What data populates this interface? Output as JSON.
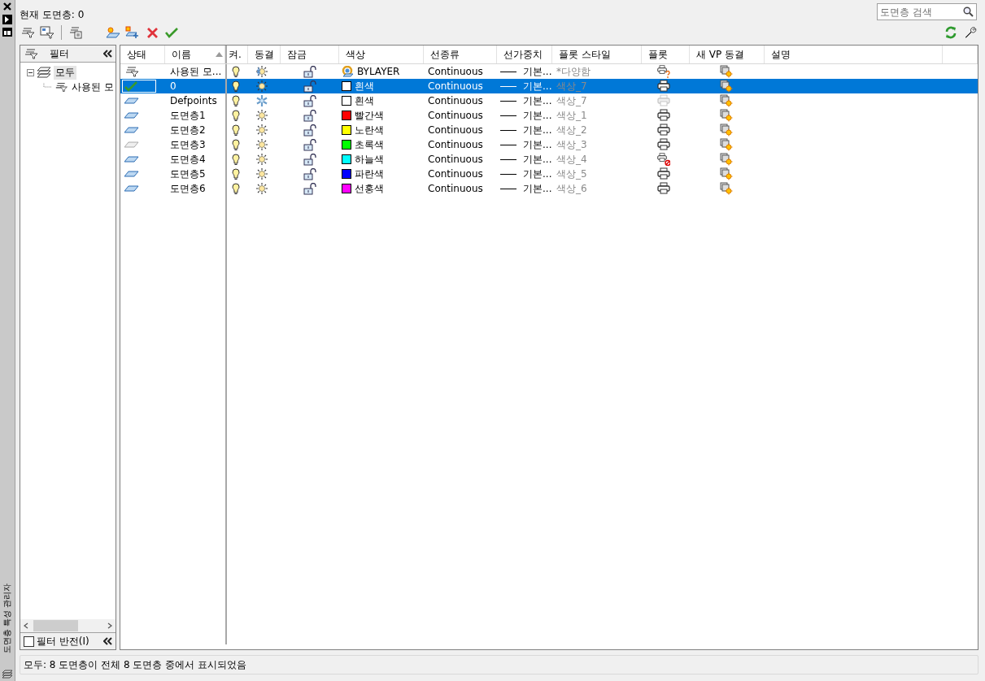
{
  "header": {
    "current_layer": "현재 도면층: 0"
  },
  "search": {
    "placeholder": "도면층 검색"
  },
  "filter_panel": {
    "title": "필터",
    "tree": [
      {
        "label": "모두",
        "selected": true,
        "expanded": true,
        "children": [
          {
            "label": "사용된 모",
            "selected": false
          }
        ]
      }
    ],
    "invert": {
      "label": "필터 반전(I)",
      "checked": false
    }
  },
  "columns": [
    {
      "label": "상태",
      "sorted": false
    },
    {
      "label": "이름",
      "sorted": true
    },
    {
      "label": "켜.",
      "sorted": false
    },
    {
      "label": "동결",
      "sorted": false
    },
    {
      "label": "잠금",
      "sorted": false
    },
    {
      "label": "색상",
      "sorted": false
    },
    {
      "label": "선종류",
      "sorted": false
    },
    {
      "label": "선가중치",
      "sorted": false
    },
    {
      "label": "플롯 스타일",
      "sorted": false
    },
    {
      "label": "플롯",
      "sorted": false
    },
    {
      "label": "새 VP 동결",
      "sorted": false
    },
    {
      "label": "설명",
      "sorted": false
    }
  ],
  "rows": [
    {
      "status": {
        "kind": "filter"
      },
      "name": "사용된 모...",
      "on": true,
      "freeze": {
        "kind": "mixed"
      },
      "locked": false,
      "color": {
        "kind": "bylayer",
        "name": "BYLAYER"
      },
      "linetype": "Continuous",
      "lineweight": "기본...",
      "plot_style": "*다양함",
      "plot": {
        "kind": "mixed"
      },
      "vp_frozen": false,
      "selected": false
    },
    {
      "status": {
        "kind": "current"
      },
      "name": "0",
      "on": true,
      "freeze": {
        "kind": "thawed"
      },
      "locked": false,
      "color": {
        "kind": "swatch",
        "color": "#ffffff",
        "name": "흰색"
      },
      "linetype": "Continuous",
      "lineweight": "기본...",
      "plot_style": "색상_7",
      "plot": {
        "kind": "yes"
      },
      "vp_frozen": false,
      "selected": true
    },
    {
      "status": {
        "kind": "used"
      },
      "name": "Defpoints",
      "on": true,
      "freeze": {
        "kind": "frozen"
      },
      "locked": false,
      "color": {
        "kind": "swatch",
        "color": "#ffffff",
        "name": "흰색"
      },
      "linetype": "Continuous",
      "lineweight": "기본...",
      "plot_style": "색상_7",
      "plot": {
        "kind": "disabled"
      },
      "vp_frozen": false,
      "selected": false
    },
    {
      "status": {
        "kind": "used"
      },
      "name": "도면층1",
      "on": true,
      "freeze": {
        "kind": "thawed"
      },
      "locked": false,
      "color": {
        "kind": "swatch",
        "color": "#ff0000",
        "name": "빨간색"
      },
      "linetype": "Continuous",
      "lineweight": "기본...",
      "plot_style": "색상_1",
      "plot": {
        "kind": "yes"
      },
      "vp_frozen": false,
      "selected": false
    },
    {
      "status": {
        "kind": "used"
      },
      "name": "도면층2",
      "on": true,
      "freeze": {
        "kind": "thawed"
      },
      "locked": false,
      "color": {
        "kind": "swatch",
        "color": "#ffff00",
        "name": "노란색"
      },
      "linetype": "Continuous",
      "lineweight": "기본...",
      "plot_style": "색상_2",
      "plot": {
        "kind": "yes"
      },
      "vp_frozen": false,
      "selected": false
    },
    {
      "status": {
        "kind": "unused"
      },
      "name": "도면층3",
      "on": true,
      "freeze": {
        "kind": "thawed"
      },
      "locked": false,
      "color": {
        "kind": "swatch",
        "color": "#00ff00",
        "name": "초록색"
      },
      "linetype": "Continuous",
      "lineweight": "기본...",
      "plot_style": "색상_3",
      "plot": {
        "kind": "yes"
      },
      "vp_frozen": false,
      "selected": false
    },
    {
      "status": {
        "kind": "used"
      },
      "name": "도면층4",
      "on": true,
      "freeze": {
        "kind": "thawed"
      },
      "locked": false,
      "color": {
        "kind": "swatch",
        "color": "#00ffff",
        "name": "하늘색"
      },
      "linetype": "Continuous",
      "lineweight": "기본...",
      "plot_style": "색상_4",
      "plot": {
        "kind": "no"
      },
      "vp_frozen": false,
      "selected": false
    },
    {
      "status": {
        "kind": "used"
      },
      "name": "도면층5",
      "on": true,
      "freeze": {
        "kind": "thawed"
      },
      "locked": false,
      "color": {
        "kind": "swatch",
        "color": "#0000ff",
        "name": "파란색"
      },
      "linetype": "Continuous",
      "lineweight": "기본...",
      "plot_style": "색상_5",
      "plot": {
        "kind": "yes"
      },
      "vp_frozen": false,
      "selected": false
    },
    {
      "status": {
        "kind": "used"
      },
      "name": "도면층6",
      "on": true,
      "freeze": {
        "kind": "thawed"
      },
      "locked": false,
      "color": {
        "kind": "swatch",
        "color": "#ff00ff",
        "name": "선홍색"
      },
      "linetype": "Continuous",
      "lineweight": "기본...",
      "plot_style": "색상_6",
      "plot": {
        "kind": "yes"
      },
      "vp_frozen": false,
      "selected": false
    }
  ],
  "status_bar": "모두: 8 도면층이 전체 8 도면층 중에서 표시되었음",
  "side_label": "도면층 특성 관리자"
}
